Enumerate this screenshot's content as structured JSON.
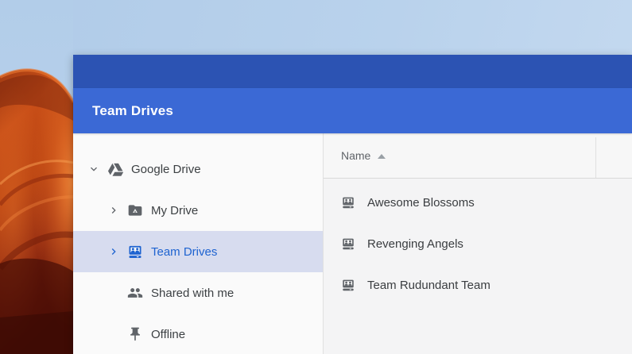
{
  "window": {
    "title": "Team Drives"
  },
  "sidebar": {
    "items": [
      {
        "label": "Google Drive",
        "icon": "google-drive-icon",
        "chevron": "down",
        "selected": false
      },
      {
        "label": "My Drive",
        "icon": "my-drive-folder-icon",
        "chevron": "right",
        "selected": false
      },
      {
        "label": "Team Drives",
        "icon": "team-drive-icon",
        "chevron": "right",
        "selected": true
      },
      {
        "label": "Shared with me",
        "icon": "people-icon",
        "chevron": "none",
        "selected": false
      },
      {
        "label": "Offline",
        "icon": "pin-icon",
        "chevron": "none",
        "selected": false
      }
    ]
  },
  "file_list": {
    "columns": [
      {
        "label": "Name",
        "sort": "ascending"
      }
    ],
    "rows": [
      {
        "name": "Awesome Blossoms",
        "icon": "team-drive-icon"
      },
      {
        "name": "Revenging Angels",
        "icon": "team-drive-icon"
      },
      {
        "name": "Team Rudundant Team",
        "icon": "team-drive-icon"
      }
    ]
  },
  "colors": {
    "titlebar": "#2c53b3",
    "header": "#3b69d5",
    "selection_bg": "#d7dcef",
    "selection_fg": "#1e63d0",
    "sidebar_bg": "#fafafa",
    "panel_bg": "#f4f4f5",
    "icon_gray": "#5f6368",
    "sky": "#b5cfe9",
    "canyon_orange": "#c94f18"
  }
}
